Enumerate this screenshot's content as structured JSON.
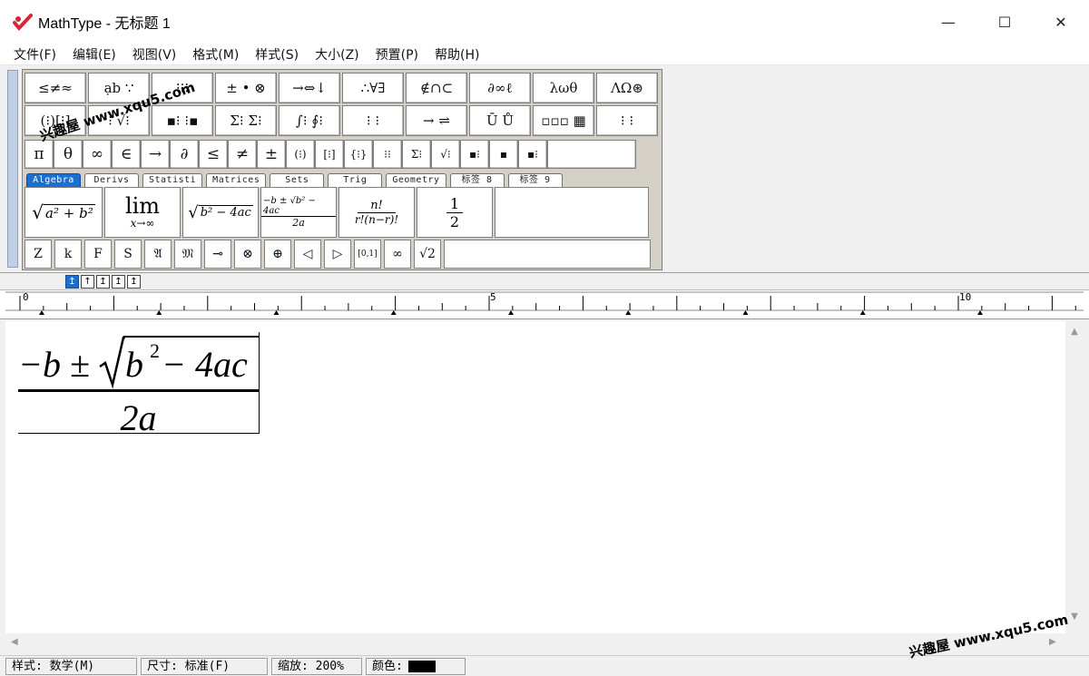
{
  "window": {
    "title": "MathType - 无标题 1",
    "minimize": "—",
    "maximize": "☐",
    "close": "✕"
  },
  "menu": [
    "文件(F)",
    "编辑(E)",
    "视图(V)",
    "格式(M)",
    "样式(S)",
    "大小(Z)",
    "预置(P)",
    "帮助(H)"
  ],
  "palette": {
    "row1": [
      "≤≠≈",
      "ạb ∵",
      "⁝⁝⁝",
      "± • ⊗",
      "→⇔↓",
      "∴∀∃",
      "∉∩⊂",
      "∂∞ℓ",
      "λωθ",
      "ΛΩ⊛"
    ],
    "row2": [
      "(⁝)[⁝]",
      "⁝ √⁝",
      "▪⁝ ⁝▪",
      "Σ⁝ Σ⁝",
      "∫⁝ ∮⁝",
      "⁝ ⁝",
      "→ ⇌",
      "Ū Ů",
      "▫▫▫ ▦",
      "⁝ ⁝"
    ],
    "row3": [
      "π",
      "θ",
      "∞",
      "∈",
      "→",
      "∂",
      "≤",
      "≠",
      "±",
      "(⁝)",
      "[⁝]",
      "{⁝}",
      "⁝⁝",
      "Σ⁝",
      "√⁝",
      "▪⁝",
      "▪",
      "▪⁝"
    ],
    "tabs": [
      "Algebra",
      "Derivs",
      "Statisti",
      "Matrices",
      "Sets",
      "Trig",
      "Geometry",
      "标签 8",
      "标签 9"
    ],
    "bottom": [
      "Z",
      "k",
      "F",
      "S",
      "𝔄",
      "𝔐",
      "⊸",
      "⊗",
      "⊕",
      "◁",
      "▷",
      "[0,1]",
      "∞",
      "√2"
    ]
  },
  "templates": {
    "sqrt_sum": "a² + b²",
    "lim_word": "lim",
    "lim_sub": "x→∞",
    "disc": "b² − 4ac",
    "quad_num": "−b ± √b² − 4ac",
    "quad_den": "2a",
    "binom_num": "n!",
    "binom_den": "r!(n−r)!",
    "half_num": "1",
    "half_den": "2"
  },
  "align_buttons": [
    "↥",
    "↑",
    "↥",
    "↥",
    "↥"
  ],
  "ruler": {
    "labels": [
      "0",
      "5",
      "10"
    ]
  },
  "equation": {
    "numerator": "−b ± ",
    "radicand_b": "b",
    "radicand_exp": "2",
    "radicand_rest": " − 4ac",
    "denominator": "2a"
  },
  "status": {
    "style": "样式: 数学(M)",
    "size": "尺寸: 标准(F)",
    "zoom": "缩放: 200%",
    "color": "颜色:"
  },
  "watermark": "兴趣屋 www.xqu5.com"
}
